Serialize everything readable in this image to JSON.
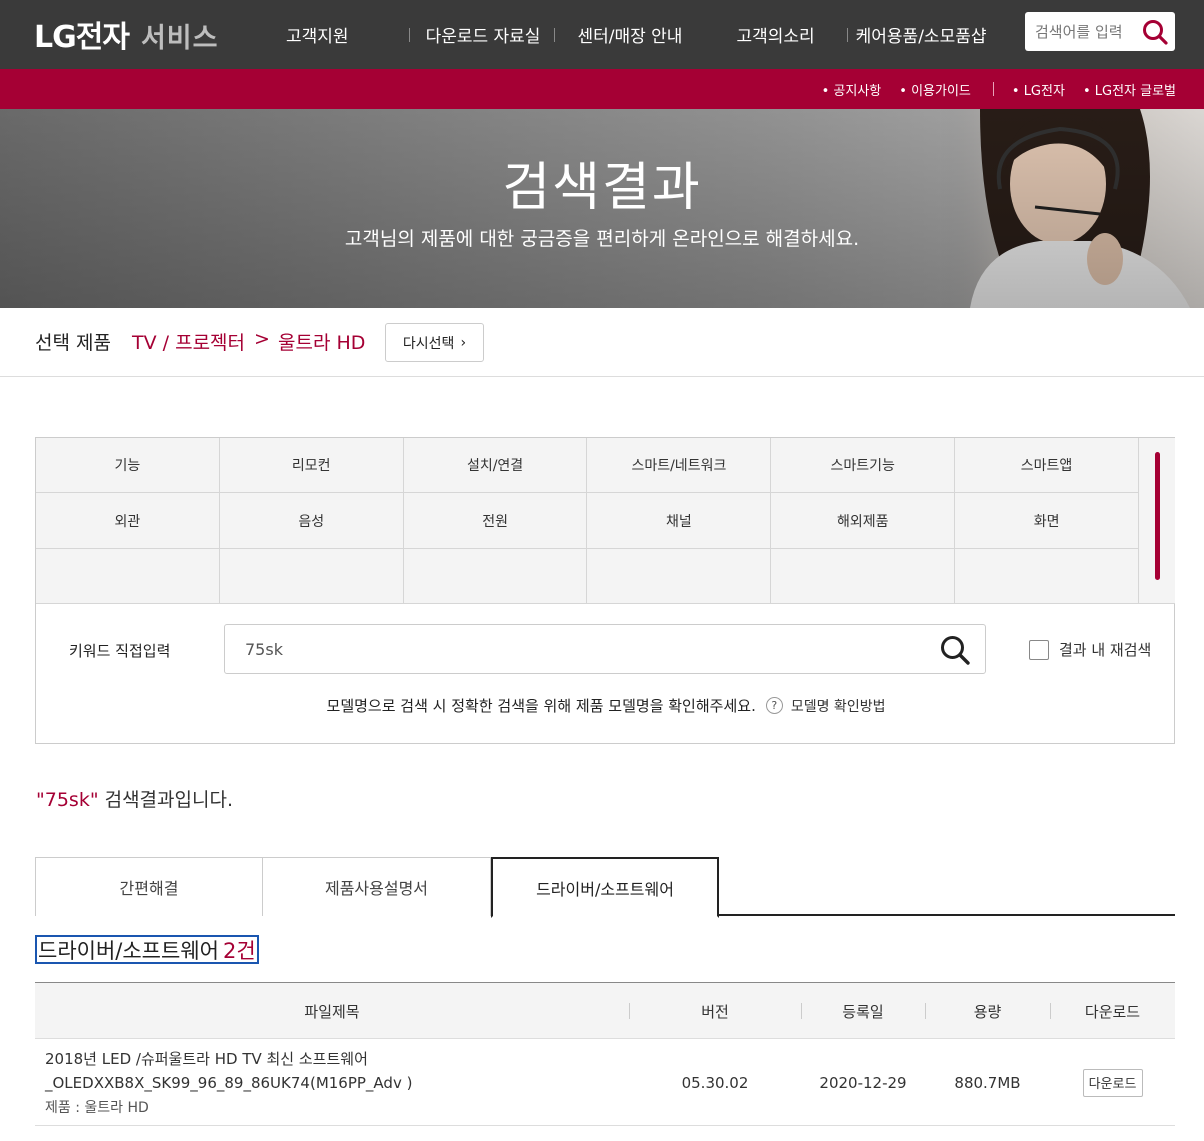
{
  "header": {
    "logo_main": "LG전자",
    "logo_sub": "서비스",
    "nav": [
      "고객지원",
      "다운로드 자료실",
      "센터/매장 안내",
      "고객의소리",
      "케어용품/소모품샵"
    ],
    "search_placeholder": "검색어를 입력"
  },
  "utility_links": [
    "공지사항",
    "이용가이드",
    "LG전자",
    "LG전자 글로벌"
  ],
  "hero": {
    "title": "검색결과",
    "subtitle": "고객님의 제품에 대한 궁금증을 편리하게 온라인으로 해결하세요."
  },
  "selected_product": {
    "label": "선택 제품",
    "category": "TV / 프로젝터",
    "separator": ">",
    "subcategory": "울트라 HD",
    "reselect_label": "다시선택"
  },
  "categories": [
    [
      "기능",
      "리모컨",
      "설치/연결",
      "스마트/네트워크",
      "스마트기능",
      "스마트앱"
    ],
    [
      "외관",
      "음성",
      "전원",
      "채널",
      "해외제품",
      "화면"
    ],
    [
      "",
      "",
      "",
      "",
      "",
      ""
    ]
  ],
  "keyword": {
    "label": "키워드 직접입력",
    "value": "75sk",
    "recheck_label": "결과 내 재검색",
    "hint": "모델명으로 검색 시 정확한 검색을 위해 제품 모델명을 확인해주세요.",
    "hint_link": "모델명 확인방법"
  },
  "result": {
    "keyword_quoted": "\"75sk\"",
    "suffix": " 검색결과입니다."
  },
  "tabs": [
    "간편해결",
    "제품사용설명서",
    "드라이버/소프트웨어"
  ],
  "section": {
    "title": "드라이버/소프트웨어",
    "count": "2건"
  },
  "table": {
    "headers": [
      "파일제목",
      "버전",
      "등록일",
      "용량",
      "다운로드"
    ],
    "rows": [
      {
        "title": "2018년 LED /슈퍼울트라 HD TV 최신 소프트웨어_OLEDXXB8X_SK99_96_89_86UK74(M16PP_Adv )",
        "product": "제품 : 울트라 HD",
        "version": "05.30.02",
        "date": "2020-12-29",
        "size": "880.7MB",
        "download_label": "다운로드"
      }
    ]
  },
  "colors": {
    "brand": "#a50034",
    "topbar": "#3a3a3a"
  }
}
